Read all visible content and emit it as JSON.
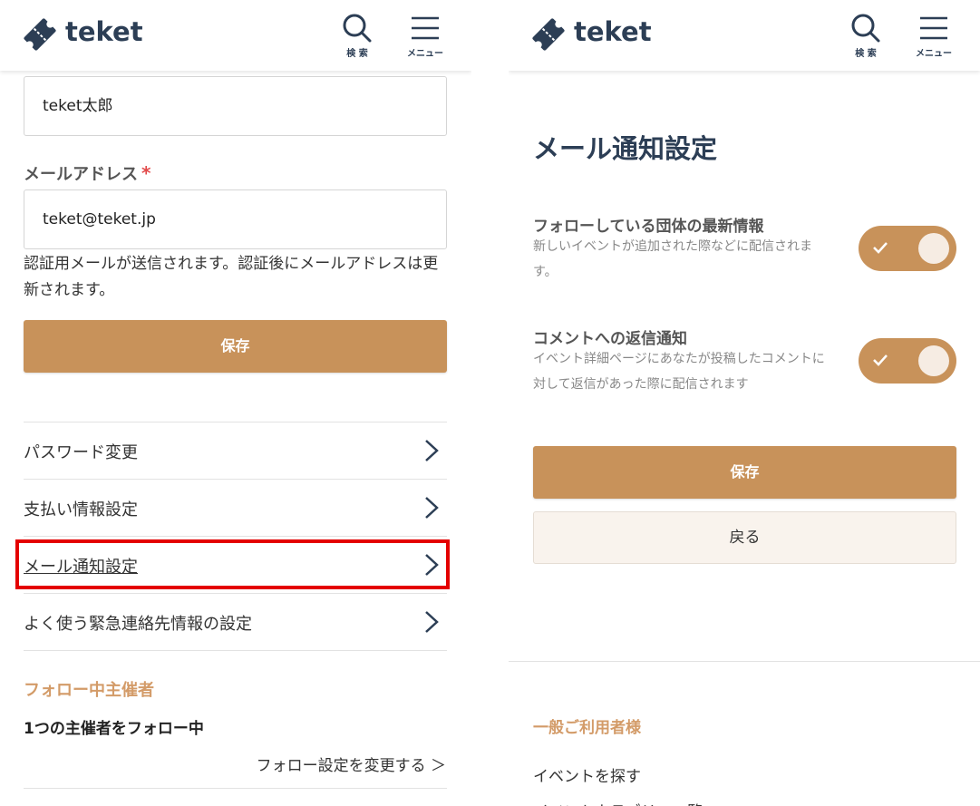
{
  "header": {
    "brand": "teket",
    "search_label": "検 索",
    "menu_label": "メニュー"
  },
  "left": {
    "name_value": "teket太郎",
    "email_label": "メールアドレス",
    "required_mark": "*",
    "email_value": "teket@teket.jp",
    "email_note": "認証用メールが送信されます。認証後にメールアドレスは更新されます。",
    "save_label": "保存",
    "settings": [
      {
        "label": "パスワード変更"
      },
      {
        "label": "支払い情報設定"
      },
      {
        "label": "メール通知設定"
      },
      {
        "label": "よく使う緊急連絡先情報の設定"
      }
    ],
    "follow_heading": "フォロー中主催者",
    "follow_count": "1つの主催者をフォロー中",
    "follow_link": "フォロー設定を変更する ＞"
  },
  "right": {
    "title": "メール通知設定",
    "notifications": [
      {
        "title": "フォローしている団体の最新情報",
        "description": "新しいイベントが追加された際などに配信されます。",
        "enabled": true
      },
      {
        "title": "コメントへの返信通知",
        "description": "イベント詳細ページにあなたが投稿したコメントに対して返信があった際に配信されます",
        "enabled": true
      }
    ],
    "save_label": "保存",
    "back_label": "戻る",
    "footer_heading": "一般ご利用者様",
    "footer_links": [
      "イベントを探す",
      "イベントカテゴリー一覧"
    ]
  },
  "colors": {
    "accent": "#c8925a",
    "accent_text": "#d39b68",
    "navy": "#2c3e55",
    "highlight": "#e40000"
  }
}
